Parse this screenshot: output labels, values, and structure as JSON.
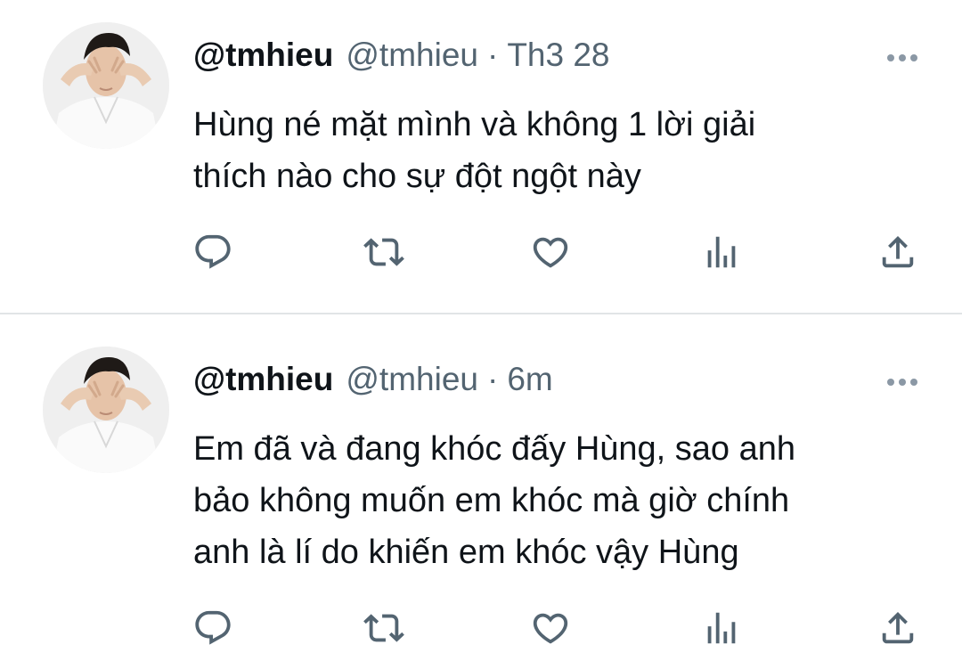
{
  "tweets": [
    {
      "display_name": "@tmhieu",
      "handle": "@tmhieu",
      "separator": "·",
      "time": "Th3 28",
      "text_lines": [
        "Hùng né mặt mình và không 1 lời giải",
        "thích nào cho sự đột ngột này"
      ],
      "actions": [
        "reply-icon",
        "retweet-icon",
        "like-icon",
        "views-icon",
        "share-icon"
      ]
    },
    {
      "display_name": "@tmhieu",
      "handle": "@tmhieu",
      "separator": "·",
      "time": "6m",
      "text_lines": [
        "Em đã và đang khóc đấy Hùng, sao anh",
        "bảo không muốn em khóc mà giờ chính",
        "anh là lí do khiến em khóc vậy Hùng"
      ],
      "actions": [
        "reply-icon",
        "retweet-icon",
        "like-icon",
        "views-icon",
        "share-icon"
      ]
    }
  ],
  "colors": {
    "text": "#0f1419",
    "secondary": "#536471",
    "icon": "#536471",
    "divider": "#e1e4e6"
  }
}
